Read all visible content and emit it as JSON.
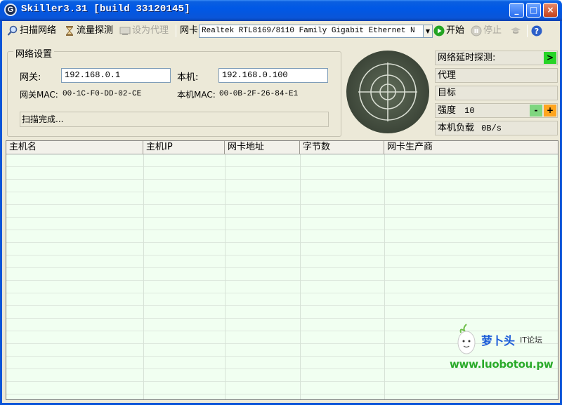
{
  "window": {
    "title": "Skiller3.31 [build 33120145]",
    "app_icon_letter": "G",
    "minimize_glyph": "_",
    "maximize_glyph": "□",
    "close_glyph": "×"
  },
  "toolbar": {
    "scan_network": "扫描网络",
    "traffic_probe": "流量探测",
    "set_proxy": "设为代理",
    "nic_label": "网卡",
    "nic_value": "Realtek RTL8169/8110 Family Gigabit Ethernet N",
    "start": "开始",
    "stop": "停止"
  },
  "network_settings": {
    "title": "网络设置",
    "gateway_label": "网关:",
    "gateway_value": "192.168.0.1",
    "local_label": "本机:",
    "local_value": "192.168.0.100",
    "gateway_mac_label": "网关MAC:",
    "gateway_mac_value": "00-1C-F0-DD-02-CE",
    "local_mac_label": "本机MAC:",
    "local_mac_value": "00-0B-2F-26-84-E1",
    "status": "扫描完成..."
  },
  "right_panel": {
    "latency_probe": "网络延时探测:",
    "proxy": "代理",
    "target": "目标",
    "strength_label": "强度",
    "strength_value": "10",
    "load_label": "本机负载",
    "load_value": "0B/s",
    "go_glyph": ">",
    "minus_glyph": "-",
    "plus_glyph": "+"
  },
  "table": {
    "columns": [
      "主机名",
      "主机IP",
      "网卡地址",
      "字节数",
      "网卡生产商"
    ],
    "rows": []
  },
  "watermark": {
    "brand": "萝卜头",
    "forum": "IT论坛",
    "url": "www.luobotou.pw"
  }
}
